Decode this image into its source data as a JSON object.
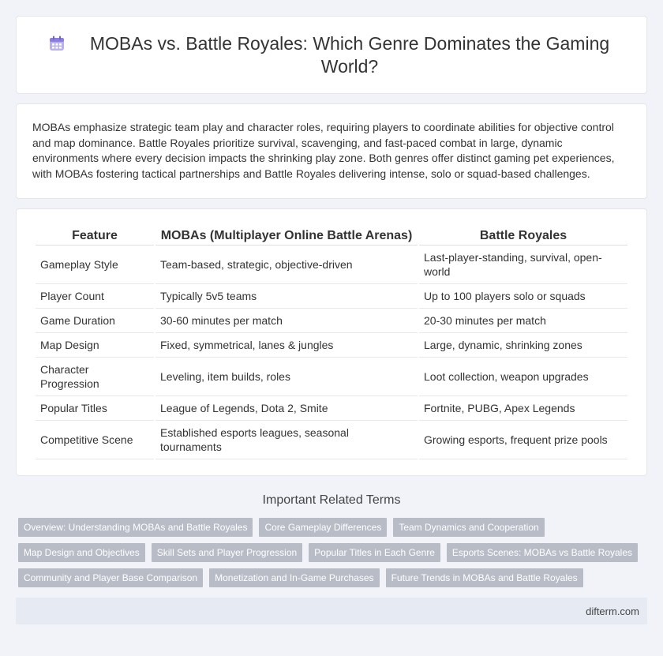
{
  "header": {
    "icon": "calendar-icon",
    "title": "MOBAs vs. Battle Royales: Which Genre Dominates the Gaming World?"
  },
  "intro": {
    "text": "MOBAs emphasize strategic team play and character roles, requiring players to coordinate abilities for objective control and map dominance. Battle Royales prioritize survival, scavenging, and fast-paced combat in large, dynamic environments where every decision impacts the shrinking play zone. Both genres offer distinct gaming pet experiences, with MOBAs fostering tactical partnerships and Battle Royales delivering intense, solo or squad-based challenges."
  },
  "table": {
    "headers": [
      "Feature",
      "MOBAs (Multiplayer Online Battle Arenas)",
      "Battle Royales"
    ],
    "rows": [
      [
        "Gameplay Style",
        "Team-based, strategic, objective-driven",
        "Last-player-standing, survival, open-world"
      ],
      [
        "Player Count",
        "Typically 5v5 teams",
        "Up to 100 players solo or squads"
      ],
      [
        "Game Duration",
        "30-60 minutes per match",
        "20-30 minutes per match"
      ],
      [
        "Map Design",
        "Fixed, symmetrical, lanes & jungles",
        "Large, dynamic, shrinking zones"
      ],
      [
        "Character Progression",
        "Leveling, item builds, roles",
        "Loot collection, weapon upgrades"
      ],
      [
        "Popular Titles",
        "League of Legends, Dota 2, Smite",
        "Fortnite, PUBG, Apex Legends"
      ],
      [
        "Competitive Scene",
        "Established esports leagues, seasonal tournaments",
        "Growing esports, frequent prize pools"
      ]
    ]
  },
  "related": {
    "title": "Important Related Terms",
    "tags": [
      "Overview: Understanding MOBAs and Battle Royales",
      "Core Gameplay Differences",
      "Team Dynamics and Cooperation",
      "Map Design and Objectives",
      "Skill Sets and Player Progression",
      "Popular Titles in Each Genre",
      "Esports Scenes: MOBAs vs Battle Royales",
      "Community and Player Base Comparison",
      "Monetization and In-Game Purchases",
      "Future Trends in MOBAs and Battle Royales"
    ]
  },
  "footer": {
    "site": "difterm.com"
  },
  "colors": {
    "background": "#f1f3f8",
    "tag": "#b8bcc6",
    "footer": "#e6eaf3",
    "icon": "#8c7ee0"
  }
}
